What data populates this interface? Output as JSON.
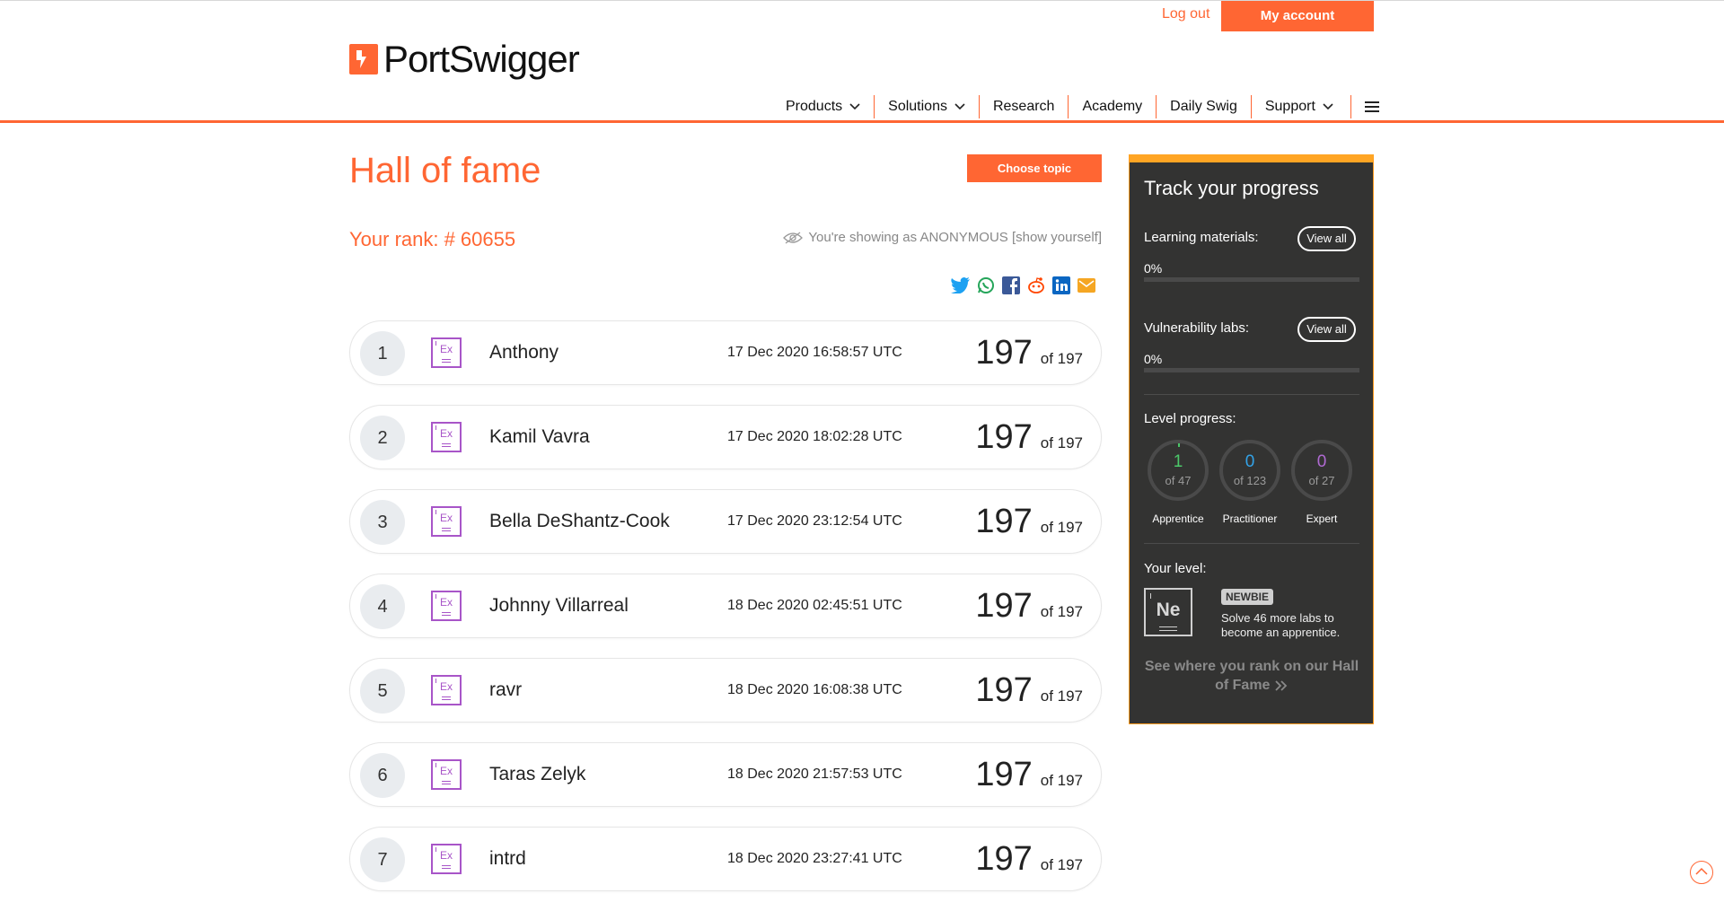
{
  "header": {
    "logout_label": "Log out",
    "myaccount_label": "My account",
    "logo_text": "PortSwigger",
    "nav": [
      "Products",
      "Solutions",
      "Research",
      "Academy",
      "Daily Swig",
      "Support"
    ]
  },
  "main": {
    "title": "Hall of fame",
    "choose_topic_label": "Choose topic",
    "rank_text": "Your rank: # 60655",
    "anon_text": "You're showing as ANONYMOUS [show yourself]",
    "share_icons": [
      "twitter-icon",
      "whatsapp-icon",
      "facebook-icon",
      "reddit-icon",
      "linkedin-icon",
      "email-icon"
    ],
    "rows": [
      {
        "rank": "1",
        "badge": "Ex",
        "name": "Anthony",
        "date": "17 Dec 2020 16:58:57 UTC",
        "score": "197",
        "of": "of 197"
      },
      {
        "rank": "2",
        "badge": "Ex",
        "name": "Kamil Vavra",
        "date": "17 Dec 2020 18:02:28 UTC",
        "score": "197",
        "of": "of 197"
      },
      {
        "rank": "3",
        "badge": "Ex",
        "name": "Bella DeShantz-Cook",
        "date": "17 Dec 2020 23:12:54 UTC",
        "score": "197",
        "of": "of 197"
      },
      {
        "rank": "4",
        "badge": "Ex",
        "name": "Johnny Villarreal",
        "date": "18 Dec 2020 02:45:51 UTC",
        "score": "197",
        "of": "of 197"
      },
      {
        "rank": "5",
        "badge": "Ex",
        "name": "ravr",
        "date": "18 Dec 2020 16:08:38 UTC",
        "score": "197",
        "of": "of 197"
      },
      {
        "rank": "6",
        "badge": "Ex",
        "name": "Taras Zelyk",
        "date": "18 Dec 2020 21:57:53 UTC",
        "score": "197",
        "of": "of 197"
      },
      {
        "rank": "7",
        "badge": "Ex",
        "name": "intrd",
        "date": "18 Dec 2020 23:27:41 UTC",
        "score": "197",
        "of": "of 197"
      }
    ]
  },
  "panel": {
    "title": "Track your progress",
    "learning_label": "Learning materials:",
    "learning_pct": "0%",
    "vuln_label": "Vulnerability labs:",
    "vuln_pct": "0%",
    "view_all_label": "View all",
    "level_progress_label": "Level progress:",
    "levels": [
      {
        "value": "1",
        "of": "of 47",
        "label": "Apprentice",
        "color": "#4cc96a"
      },
      {
        "value": "0",
        "of": "of 123",
        "label": "Practitioner",
        "color": "#33a3e8"
      },
      {
        "value": "0",
        "of": "of 27",
        "label": "Expert",
        "color": "#b06ad2"
      }
    ],
    "your_level_label": "Your level:",
    "level_symbol": "Ne",
    "level_badge": "NEWBIE",
    "solve_text": "Solve 46 more labs to become an apprentice.",
    "hof_text": "See where you rank on our Hall of Fame"
  },
  "colors": {
    "accent": "#ff6633",
    "panel_bg": "#333332",
    "panel_border": "#ffa524",
    "expert_purple": "#a855c8"
  }
}
